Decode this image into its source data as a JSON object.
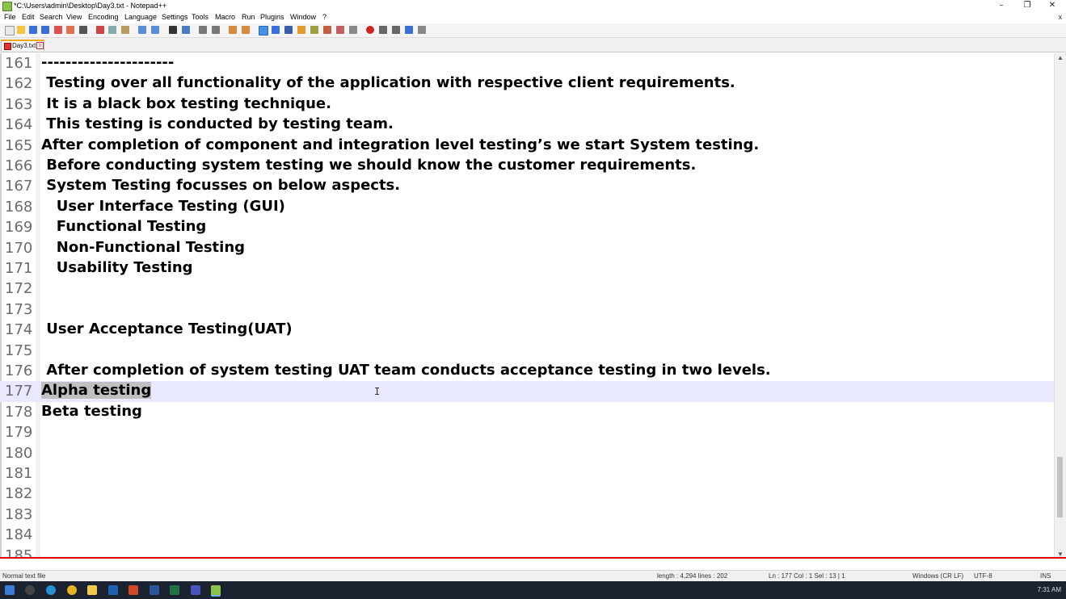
{
  "window": {
    "title": "*C:\\Users\\admin\\Desktop\\Day3.txt - Notepad++",
    "minimize": "–",
    "restore": "❐",
    "close": "✕",
    "close_doc": "x"
  },
  "menu": [
    "File",
    "Edit",
    "Search",
    "View",
    "Encoding",
    "Language",
    "Settings",
    "Tools",
    "Macro",
    "Run",
    "Plugins",
    "Window",
    "?"
  ],
  "tab": {
    "label": "Day3.txt",
    "close": "x"
  },
  "editor": {
    "lines": [
      {
        "num": "161",
        "text": "----------------------"
      },
      {
        "num": "162",
        "text": " Testing over all functionality of the application with respective client requirements."
      },
      {
        "num": "163",
        "text": " It is a black box testing technique."
      },
      {
        "num": "164",
        "text": " This testing is conducted by testing team."
      },
      {
        "num": "165",
        "text": "After completion of component and integration level testing’s we start System testing."
      },
      {
        "num": "166",
        "text": " Before conducting system testing we should know the customer requirements."
      },
      {
        "num": "167",
        "text": " System Testing focusses on below aspects."
      },
      {
        "num": "168",
        "text": "   User Interface Testing (GUI)"
      },
      {
        "num": "169",
        "text": "   Functional Testing"
      },
      {
        "num": "170",
        "text": "   Non-Functional Testing"
      },
      {
        "num": "171",
        "text": "   Usability Testing"
      },
      {
        "num": "172",
        "text": ""
      },
      {
        "num": "173",
        "text": ""
      },
      {
        "num": "174",
        "text": " User Acceptance Testing(UAT)"
      },
      {
        "num": "175",
        "text": ""
      },
      {
        "num": "176",
        "text": " After completion of system testing UAT team conducts acceptance testing in two levels."
      },
      {
        "num": "177",
        "text": "Alpha testing"
      },
      {
        "num": "178",
        "text": "Beta testing"
      },
      {
        "num": "179",
        "text": ""
      },
      {
        "num": "180",
        "text": ""
      },
      {
        "num": "181",
        "text": ""
      },
      {
        "num": "182",
        "text": ""
      },
      {
        "num": "183",
        "text": ""
      },
      {
        "num": "184",
        "text": ""
      },
      {
        "num": "185",
        "text": ""
      }
    ],
    "current_line": "177",
    "text_cursor": "I"
  },
  "scrollbar": {
    "up": "▲",
    "down": "▼"
  },
  "status": {
    "file_type": "Normal text file",
    "length": "length : 4,294    lines : 202",
    "position": "Ln : 177    Col : 1    Sel : 13 | 1",
    "eol": "Windows (CR LF)",
    "encoding": "UTF-8",
    "mode": "INS"
  },
  "taskbar": {
    "clock": "7:31 AM"
  }
}
